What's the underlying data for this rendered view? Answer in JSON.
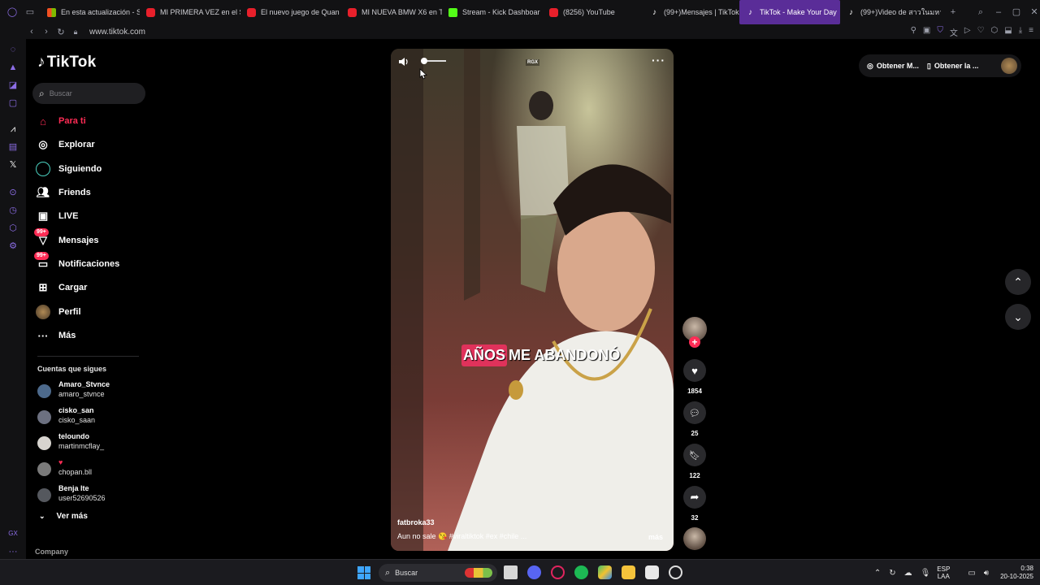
{
  "browser": {
    "tabs": [
      {
        "title": "En esta actualización - S",
        "icon": "windows-icon",
        "active": false
      },
      {
        "title": "MI PRIMERA VEZ en el S",
        "icon": "youtube-icon",
        "active": false
      },
      {
        "title": "El nuevo juego de Quan",
        "icon": "youtube-icon",
        "active": false
      },
      {
        "title": "MI NUEVA BMW X6 en T",
        "icon": "youtube-icon",
        "active": false
      },
      {
        "title": "Stream - Kick Dashboar",
        "icon": "kick-icon",
        "active": false
      },
      {
        "title": "(8256) YouTube",
        "icon": "youtube-icon",
        "active": false
      },
      {
        "title": "(99+)Mensajes | TikTok",
        "icon": "tiktok-icon",
        "active": false
      },
      {
        "title": "TikTok - Make Your Day",
        "icon": "tiktok-icon",
        "active": true
      },
      {
        "title": "(99+)Video de สาวในมหา",
        "icon": "tiktok-icon",
        "active": false
      }
    ],
    "url": "www.tiktok.com"
  },
  "sidebar": {
    "logo": "TikTok",
    "search_placeholder": "Buscar",
    "nav": [
      {
        "label": "Para ti",
        "icon": "home-icon",
        "active": true
      },
      {
        "label": "Explorar",
        "icon": "compass-icon"
      },
      {
        "label": "Siguiendo",
        "icon": "following-icon"
      },
      {
        "label": "Friends",
        "icon": "friends-icon"
      },
      {
        "label": "LIVE",
        "icon": "live-icon"
      },
      {
        "label": "Mensajes",
        "icon": "messages-icon",
        "badge": "99+"
      },
      {
        "label": "Notificaciones",
        "icon": "notifications-icon",
        "badge": "99+"
      },
      {
        "label": "Cargar",
        "icon": "upload-icon"
      },
      {
        "label": "Perfil",
        "icon": "profile-icon"
      },
      {
        "label": "Más",
        "icon": "more-icon"
      }
    ],
    "following_title": "Cuentas que sigues",
    "accounts": [
      {
        "name": "Amaro_Stvnce",
        "handle": "amaro_stvnce"
      },
      {
        "name": "cisko_san",
        "handle": "cisko_saan"
      },
      {
        "name": "teloundo",
        "handle": "martinmcflay_"
      },
      {
        "name": "♥",
        "handle": "chopan.bll"
      },
      {
        "name": "Benja lte",
        "handle": "user52690526"
      }
    ],
    "see_more": "Ver más",
    "company": "Company"
  },
  "video": {
    "watermark": "RGX",
    "caption_highlight": "AÑOS",
    "caption_rest": "ME ABANDONÓ",
    "author": "fatbroka33",
    "description": "Aun no sale 😘 #viraltiktok  #ex  #chile  ...",
    "more": "más",
    "volume": 0.15
  },
  "actions": {
    "likes": "1854",
    "comments": "25",
    "saves": "122",
    "shares": "32"
  },
  "topright": {
    "coins_label": "Obtener M...",
    "app_label": "Obtener la ..."
  },
  "taskbar": {
    "search": "Buscar",
    "lang_top": "ESP",
    "lang_bottom": "LAA",
    "time": "0:38",
    "date": "20-10-2025"
  },
  "colors": {
    "accent": "#fe2c55",
    "active_tab": "#5a2d98",
    "caption_highlight": "#e0325b"
  }
}
